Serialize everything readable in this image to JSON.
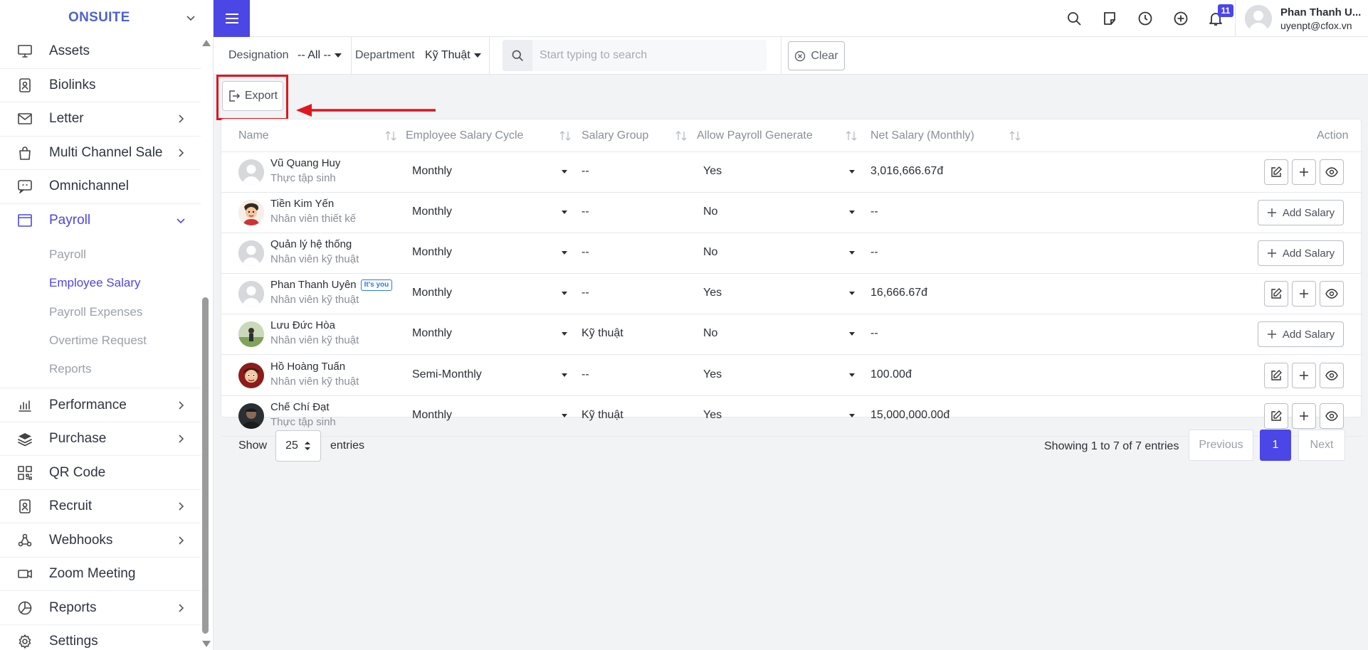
{
  "sidebar": {
    "brand": "ONSUITE",
    "items": [
      {
        "label": "Assets",
        "icon": "monitor-icon",
        "chevron": false
      },
      {
        "label": "Biolinks",
        "icon": "id-badge-icon",
        "chevron": false
      },
      {
        "label": "Letter",
        "icon": "envelope-icon",
        "chevron": true
      },
      {
        "label": "Multi Channel Sale",
        "icon": "shopping-bag-icon",
        "chevron": true
      },
      {
        "label": "Omnichannel",
        "icon": "chat-icon",
        "chevron": false
      },
      {
        "label": "Payroll",
        "icon": "browser-window-icon",
        "chevron": true,
        "active": true
      }
    ],
    "payroll_sub": [
      "Payroll",
      "Employee Salary",
      "Payroll Expenses",
      "Overtime Request",
      "Reports"
    ],
    "items_after": [
      {
        "label": "Performance",
        "icon": "bar-chart-icon",
        "chevron": true
      },
      {
        "label": "Purchase",
        "icon": "layers-icon",
        "chevron": true
      },
      {
        "label": "QR Code",
        "icon": "qr-code-icon",
        "chevron": false
      },
      {
        "label": "Recruit",
        "icon": "id-badge-icon",
        "chevron": true
      },
      {
        "label": "Webhooks",
        "icon": "webhook-icon",
        "chevron": true
      },
      {
        "label": "Zoom Meeting",
        "icon": "video-camera-icon",
        "chevron": false
      },
      {
        "label": "Reports",
        "icon": "pie-chart-icon",
        "chevron": true
      },
      {
        "label": "Settings",
        "icon": "gear-icon",
        "chevron": false
      }
    ]
  },
  "topbar": {
    "notification_count": "11",
    "user_name": "Phan Thanh U...",
    "user_email": "uyenpt@cfox.vn"
  },
  "filters": {
    "designation_label": "Designation",
    "designation_value": "-- All --",
    "department_label": "Department",
    "department_value": "Kỹ Thuật",
    "search_placeholder": "Start typing to search",
    "clear_label": "Clear"
  },
  "toolbar": {
    "export_label": "Export"
  },
  "table": {
    "columns": [
      "Name",
      "Employee Salary Cycle",
      "Salary Group",
      "Allow Payroll Generate",
      "Net Salary (Monthly)",
      "Action"
    ],
    "add_salary_label": "Add Salary",
    "you_badge": "It's you",
    "rows": [
      {
        "name": "Vũ Quang Huy",
        "role": "Thực tập sinh",
        "cycle": "Monthly",
        "group": "--",
        "allow": "Yes",
        "net": "3,016,666.67đ",
        "has_salary": true,
        "avatar": "default"
      },
      {
        "name": "Tiền Kim Yến",
        "role": "Nhân viên thiết kế",
        "cycle": "Monthly",
        "group": "--",
        "allow": "No",
        "net": "--",
        "has_salary": false,
        "avatar": "cartoon"
      },
      {
        "name": "Quản lý hệ thống",
        "role": "Nhân viên kỹ thuật",
        "cycle": "Monthly",
        "group": "--",
        "allow": "No",
        "net": "--",
        "has_salary": false,
        "avatar": "default"
      },
      {
        "name": "Phan Thanh Uyên",
        "role": "Nhân viên kỹ thuật",
        "cycle": "Monthly",
        "group": "--",
        "allow": "Yes",
        "net": "16,666.67đ",
        "has_salary": true,
        "avatar": "default",
        "is_you": true
      },
      {
        "name": "Lưu Đức Hòa",
        "role": "Nhân viên kỹ thuật",
        "cycle": "Monthly",
        "group": "Kỹ thuật",
        "allow": "No",
        "net": "--",
        "has_salary": false,
        "avatar": "photo-green"
      },
      {
        "name": "Hồ Hoàng Tuấn",
        "role": "Nhân viên kỹ thuật",
        "cycle": "Semi-Monthly",
        "group": "--",
        "allow": "Yes",
        "net": "100.00đ",
        "has_salary": true,
        "avatar": "cartoon-red"
      },
      {
        "name": "Chế Chí Đạt",
        "role": "Thực tập sinh",
        "cycle": "Monthly",
        "group": "Kỹ thuật",
        "allow": "Yes",
        "net": "15,000,000.00đ",
        "has_salary": true,
        "avatar": "photo-dark"
      }
    ]
  },
  "footer": {
    "show_label": "Show",
    "entries_value": "25",
    "entries_label": "entries",
    "showing_text": "Showing 1 to 7 of 7 entries",
    "previous_label": "Previous",
    "current_page": "1",
    "next_label": "Next"
  },
  "colors": {
    "accent": "#4b46e6",
    "brand": "#4d63cc",
    "annotation_red": "#e0161e"
  }
}
